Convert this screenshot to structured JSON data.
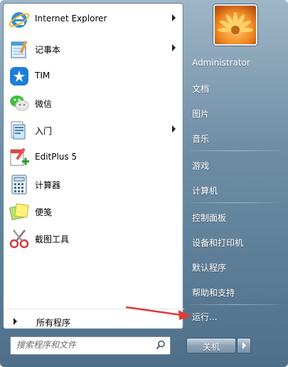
{
  "programs": [
    {
      "label": "Internet Explorer",
      "icon": "internet-explorer-icon",
      "has_submenu": true
    },
    {
      "label": "记事本",
      "icon": "notepad-icon",
      "has_submenu": true
    },
    {
      "label": "TIM",
      "icon": "tim-icon",
      "has_submenu": false
    },
    {
      "label": "微信",
      "icon": "wechat-icon",
      "has_submenu": false
    },
    {
      "label": "入门",
      "icon": "getting-started-icon",
      "has_submenu": true
    },
    {
      "label": "EditPlus 5",
      "icon": "editplus-icon",
      "has_submenu": false
    },
    {
      "label": "计算器",
      "icon": "calculator-icon",
      "has_submenu": false
    },
    {
      "label": "便笺",
      "icon": "sticky-notes-icon",
      "has_submenu": false
    },
    {
      "label": "截图工具",
      "icon": "snipping-tool-icon",
      "has_submenu": false
    }
  ],
  "all_programs_label": "所有程序",
  "search": {
    "placeholder": "搜索程序和文件"
  },
  "right_pane": {
    "user": "Administrator",
    "documents": "文档",
    "pictures": "图片",
    "music": "音乐",
    "games": "游戏",
    "computer": "计算机",
    "control_panel": "控制面板",
    "devices_printers": "设备和打印机",
    "default_programs": "默认程序",
    "help_support": "帮助和支持",
    "run": "运行..."
  },
  "shutdown": {
    "label": "关机"
  },
  "colors": {
    "frame_top": "#9fb6c7",
    "frame_bottom": "#4e6f89",
    "annotation_arrow": "#e53935"
  }
}
